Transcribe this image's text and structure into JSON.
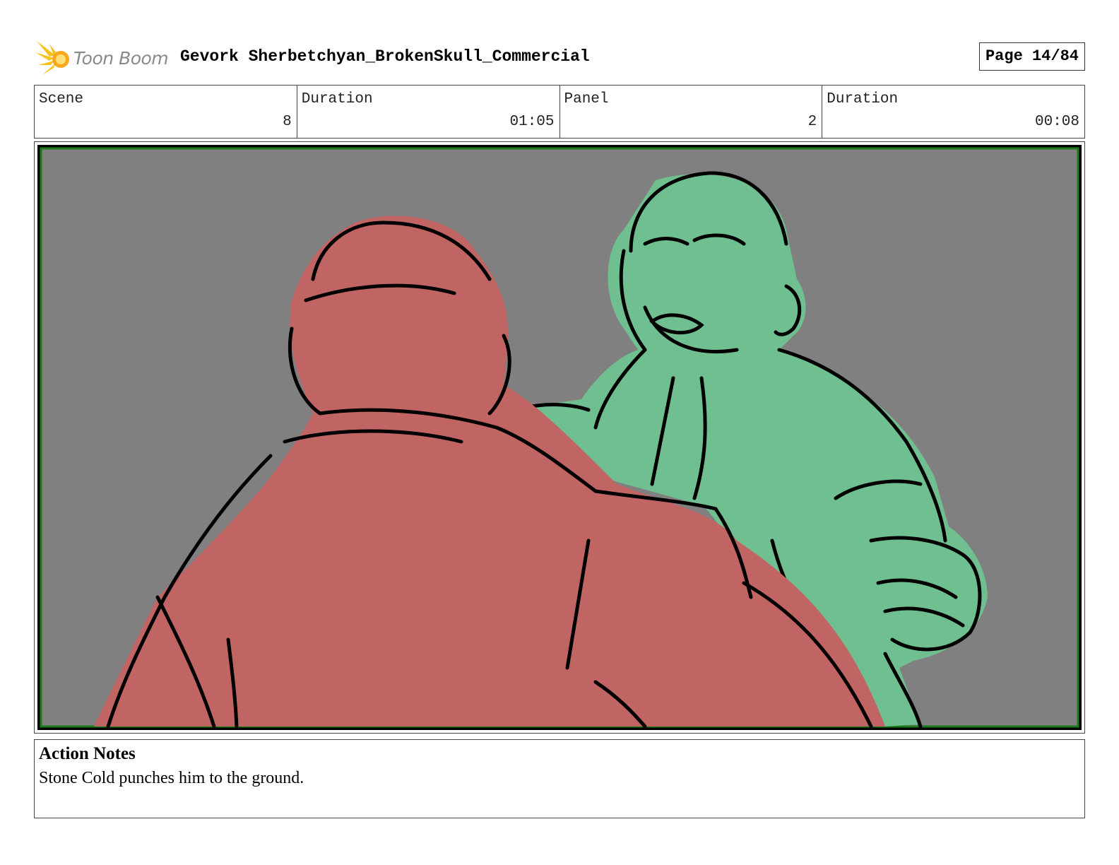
{
  "header": {
    "logo_label": "Toon Boom",
    "title": "Gevork Sherbetchyan_BrokenSkull_Commercial",
    "page": "Page 14/84"
  },
  "info": {
    "scene_label": "Scene",
    "scene_value": "8",
    "scene_duration_label": "Duration",
    "scene_duration_value": "01:05",
    "panel_label": "Panel",
    "panel_value": "2",
    "panel_duration_label": "Duration",
    "panel_duration_value": "00:08"
  },
  "panel": {
    "background_color": "#808080",
    "border_color": "#1a7a1a",
    "figure_front_color": "#c06464",
    "figure_back_color": "#6fbf90"
  },
  "notes": {
    "title": "Action Notes",
    "body": "Stone Cold punches him to the ground."
  }
}
